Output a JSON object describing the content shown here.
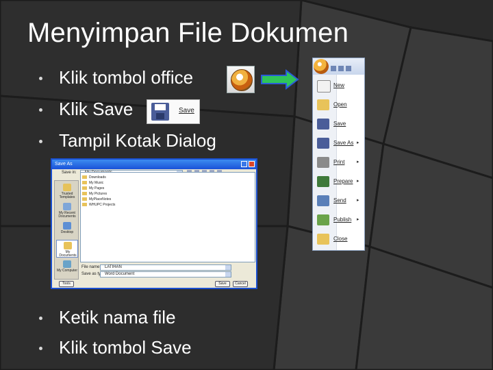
{
  "slide": {
    "title": "Menyimpan File Dokumen",
    "bullets_top": [
      "Klik tombol office",
      "Klik Save",
      "Tampil Kotak Dialog"
    ],
    "bullets_bottom": [
      "Ketik nama file",
      "Klik tombol Save"
    ]
  },
  "save_button_thumb": {
    "label": "Save"
  },
  "office_menu": {
    "items": [
      {
        "label": "New",
        "icon": "new-document-icon",
        "submenu": false
      },
      {
        "label": "Open",
        "icon": "open-folder-icon",
        "submenu": false
      },
      {
        "label": "Save",
        "icon": "floppy-disk-icon",
        "submenu": false
      },
      {
        "label": "Save As",
        "icon": "save-as-icon",
        "submenu": true
      },
      {
        "label": "Print",
        "icon": "printer-icon",
        "submenu": true
      },
      {
        "label": "Prepare",
        "icon": "prepare-icon",
        "submenu": true
      },
      {
        "label": "Send",
        "icon": "send-icon",
        "submenu": true
      },
      {
        "label": "Publish",
        "icon": "publish-icon",
        "submenu": true
      },
      {
        "label": "Close",
        "icon": "folder-close-icon",
        "submenu": false
      }
    ],
    "submenu_arrow": "▸"
  },
  "dialog": {
    "title": "Save As",
    "save_in_label": "Save in:",
    "save_in_value": "My Documents",
    "places": [
      "Trusted Templates",
      "My Recent Documents",
      "Desktop",
      "My Documents",
      "My Computer"
    ],
    "files": [
      "Downloads",
      "My Music",
      "My Pages",
      "My Pictures",
      "MyPlaceNotes",
      "WHUPC Projects"
    ],
    "file_name_label": "File name:",
    "file_name_value": "LATIHAN",
    "save_as_type_label": "Save as type:",
    "save_as_type_value": "Word Document",
    "tools_label": "Tools",
    "save_label": "Save",
    "cancel_label": "Cancel"
  },
  "colors": {
    "background": "#2a2a2a",
    "arrow_green": "#2fc45a",
    "arrow_border": "#2b5bd8",
    "dialog_title": "#1a52d8"
  }
}
